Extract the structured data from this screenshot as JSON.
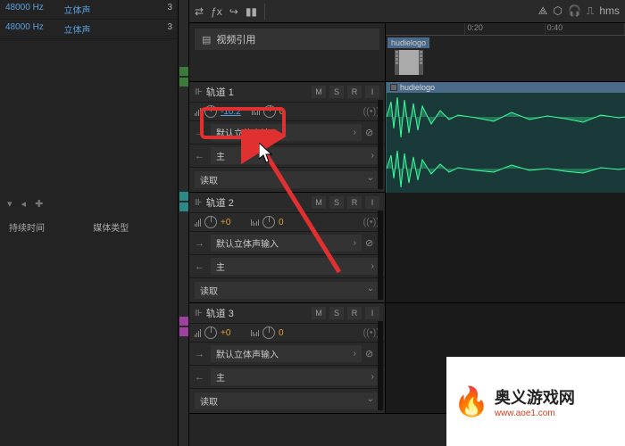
{
  "left": {
    "rows": [
      {
        "hz": "48000 Hz",
        "mode": "立体声",
        "ch": "3"
      },
      {
        "hz": "48000 Hz",
        "mode": "立体声",
        "ch": "3"
      }
    ],
    "labels": {
      "duration": "持续时间",
      "media": "媒体类型"
    }
  },
  "timeline": {
    "hms": "hms",
    "ticks": [
      "",
      "0:20",
      "0:40"
    ],
    "clipName": "hudielogo",
    "videoRef": "视频引用"
  },
  "tracks": [
    {
      "name": "轨道 1",
      "buttons": {
        "m": "M",
        "s": "S",
        "r": "R",
        "i": "I"
      },
      "vol": "-10.2",
      "pan": "0",
      "input": "默认立体声输入",
      "output": "主",
      "mode": "读取",
      "wave": "hudielogo"
    },
    {
      "name": "轨道 2",
      "buttons": {
        "m": "M",
        "s": "S",
        "r": "R",
        "i": "I"
      },
      "vol": "+0",
      "pan": "0",
      "input": "默认立体声输入",
      "output": "主",
      "mode": "读取"
    },
    {
      "name": "轨道 3",
      "buttons": {
        "m": "M",
        "s": "S",
        "r": "R",
        "i": "I"
      },
      "vol": "+0",
      "pan": "0",
      "input": "默认立体声输入",
      "output": "主",
      "mode": "读取"
    }
  ],
  "watermark": {
    "title": "奥义游戏网",
    "url": "www.aoe1.com"
  }
}
